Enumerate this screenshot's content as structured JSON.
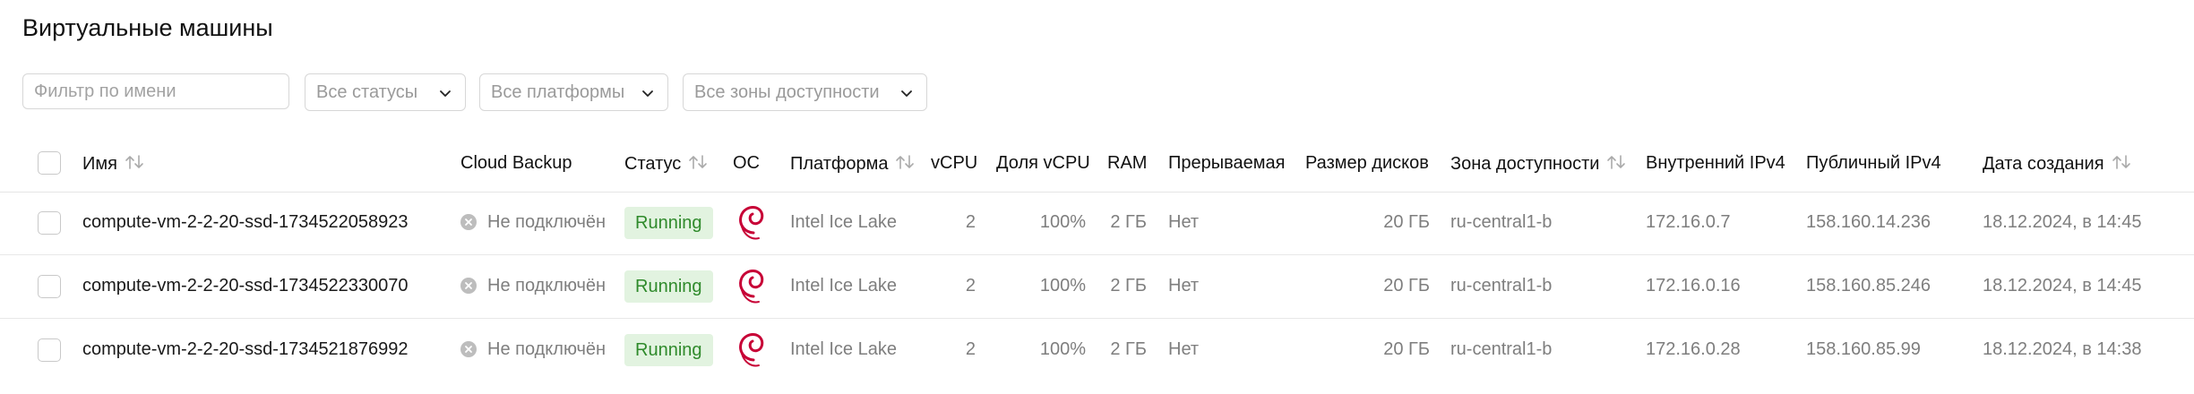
{
  "page": {
    "title": "Виртуальные машины"
  },
  "filters": {
    "name_placeholder": "Фильтр по имени",
    "status_value": "Все статусы",
    "platform_value": "Все платформы",
    "zone_value": "Все зоны доступности"
  },
  "table": {
    "headers": {
      "name": "Имя",
      "cloud_backup": "Cloud Backup",
      "status": "Статус",
      "os": "ОС",
      "platform": "Платформа",
      "vcpu": "vCPU",
      "vcpu_share": "Доля vCPU",
      "ram": "RAM",
      "preemptible": "Прерываемая",
      "disk_size": "Размер дисков",
      "zone": "Зона доступности",
      "internal_ip": "Внутренний IPv4",
      "public_ip": "Публичный IPv4",
      "created": "Дата создания"
    },
    "rows": [
      {
        "name": "compute-vm-2-2-20-ssd-1734522058923",
        "backup": "Не подключён",
        "status": "Running",
        "os_icon": "debian-logo-icon",
        "platform": "Intel Ice Lake",
        "vcpu": "2",
        "vcpu_share": "100%",
        "ram": "2 ГБ",
        "preemptible": "Нет",
        "disk": "20 ГБ",
        "zone": "ru-central1-b",
        "internal_ip": "172.16.0.7",
        "public_ip": "158.160.14.236",
        "created": "18.12.2024, в 14:45"
      },
      {
        "name": "compute-vm-2-2-20-ssd-1734522330070",
        "backup": "Не подключён",
        "status": "Running",
        "os_icon": "debian-logo-icon",
        "platform": "Intel Ice Lake",
        "vcpu": "2",
        "vcpu_share": "100%",
        "ram": "2 ГБ",
        "preemptible": "Нет",
        "disk": "20 ГБ",
        "zone": "ru-central1-b",
        "internal_ip": "172.16.0.16",
        "public_ip": "158.160.85.246",
        "created": "18.12.2024, в 14:45"
      },
      {
        "name": "compute-vm-2-2-20-ssd-1734521876992",
        "backup": "Не подключён",
        "status": "Running",
        "os_icon": "debian-logo-icon",
        "platform": "Intel Ice Lake",
        "vcpu": "2",
        "vcpu_share": "100%",
        "ram": "2 ГБ",
        "preemptible": "Нет",
        "disk": "20 ГБ",
        "zone": "ru-central1-b",
        "internal_ip": "172.16.0.28",
        "public_ip": "158.160.85.99",
        "created": "18.12.2024, в 14:38"
      }
    ]
  },
  "colors": {
    "status_running_bg": "#e2f3e0",
    "status_running_text": "#2f8a2b",
    "os_logo": "#c70036"
  }
}
